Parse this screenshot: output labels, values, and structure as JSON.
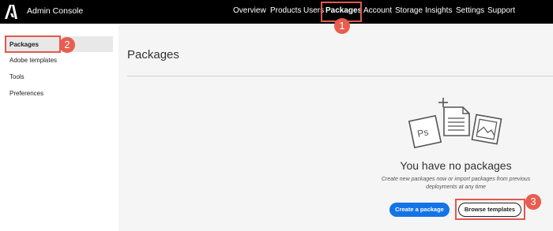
{
  "app": {
    "title": "Admin Console"
  },
  "nav": [
    {
      "label": "Overview",
      "active": false
    },
    {
      "label": "Products",
      "active": false
    },
    {
      "label": "Users",
      "active": false
    },
    {
      "label": "Packages",
      "active": true
    },
    {
      "label": "Account",
      "active": false
    },
    {
      "label": "Storage",
      "active": false
    },
    {
      "label": "Insights",
      "active": false
    },
    {
      "label": "Settings",
      "active": false
    },
    {
      "label": "Support",
      "active": false
    }
  ],
  "sidebar": {
    "items": [
      {
        "label": "Packages",
        "active": true
      },
      {
        "label": "Adobe templates",
        "active": false
      },
      {
        "label": "Tools",
        "active": false
      },
      {
        "label": "Preferences",
        "active": false
      }
    ]
  },
  "main": {
    "title": "Packages",
    "empty_title": "You have no packages",
    "empty_desc_line1": "Create new packages now or import packages from previous",
    "empty_desc_line2": "deployments at any time",
    "create_button": "Create a package",
    "browse_button": "Browse templates"
  },
  "annotations": [
    "1",
    "2",
    "3"
  ],
  "colors": {
    "accent": "#1473e6",
    "annotation": "#e85d50",
    "topbar": "#000000"
  },
  "icons": [
    "adobe-logo-icon",
    "photoshop-file-icon",
    "add-document-icon",
    "image-file-icon"
  ]
}
